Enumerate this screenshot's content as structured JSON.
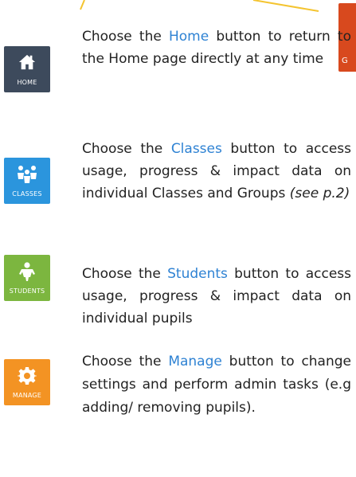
{
  "colors": {
    "callout": "#f4c430",
    "corner_tile": "#d8491e",
    "home_tile": "#3d4a5c",
    "classes_tile": "#2b95dd",
    "students_tile": "#7cb63f",
    "manage_tile": "#f39323",
    "accent_text": "#2e82d3",
    "body_text": "#222222"
  },
  "corner_tile": {
    "label": "G"
  },
  "items": [
    {
      "icon": "home-icon",
      "tile_label": "HOME",
      "desc_before": "Choose the ",
      "button_word": "Home",
      "desc_after": " button to return to the Home page directly at any time",
      "ref_note": ""
    },
    {
      "icon": "classes-icon",
      "tile_label": "CLASSES",
      "desc_before": "Choose the ",
      "button_word": "Classes",
      "desc_after": " button to access usage, progress & impact data on individual Classes and Groups ",
      "ref_note": "(see p.2)"
    },
    {
      "icon": "student-icon",
      "tile_label": "STUDENTS",
      "desc_before": "Choose the ",
      "button_word": "Students",
      "desc_after": " button to access usage, progress & impact data on individual pupils",
      "ref_note": ""
    },
    {
      "icon": "gear-icon",
      "tile_label": "MANAGE",
      "desc_before": "Choose the ",
      "button_word": "Manage",
      "desc_after": " button to change settings and perform admin tasks (e.g adding/ removing pupils).",
      "ref_note": ""
    }
  ]
}
